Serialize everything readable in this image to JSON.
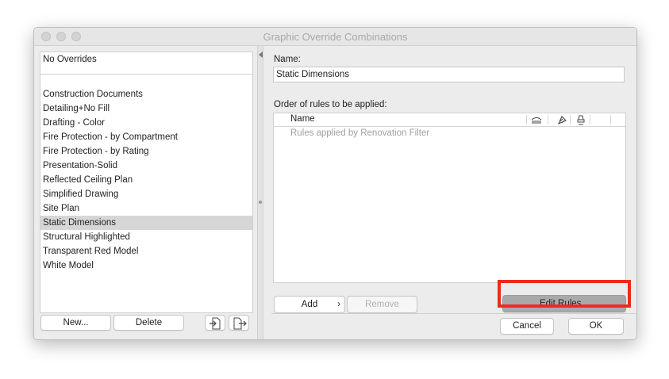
{
  "window": {
    "title": "Graphic Override Combinations"
  },
  "left": {
    "top_item": "No Overrides",
    "items": [
      {
        "label": "Construction Documents",
        "selected": false
      },
      {
        "label": "Detailing+No Fill",
        "selected": false
      },
      {
        "label": "Drafting - Color",
        "selected": false
      },
      {
        "label": "Fire Protection - by Compartment",
        "selected": false
      },
      {
        "label": "Fire Protection - by Rating",
        "selected": false
      },
      {
        "label": "Presentation-Solid",
        "selected": false
      },
      {
        "label": "Reflected Ceiling Plan",
        "selected": false
      },
      {
        "label": "Simplified Drawing",
        "selected": false
      },
      {
        "label": "Site Plan",
        "selected": false
      },
      {
        "label": "Static Dimensions",
        "selected": true
      },
      {
        "label": "Structural Highlighted",
        "selected": false
      },
      {
        "label": "Transparent Red Model",
        "selected": false
      },
      {
        "label": "White Model",
        "selected": false
      }
    ],
    "new_button": "New...",
    "delete_button": "Delete",
    "import_icon": "import-icon",
    "export_icon": "export-icon"
  },
  "right": {
    "name_label": "Name:",
    "name_value": "Static Dimensions",
    "order_label": "Order of rules to be applied:",
    "table": {
      "column_name": "Name",
      "column_icons": [
        "surface-override-icon",
        "fill-override-icon",
        "pen-override-icon"
      ],
      "rows": [
        "Rules applied by Renovation Filter"
      ]
    },
    "add_button": "Add",
    "add_chevron": "›",
    "remove_button": "Remove",
    "edit_rules_button": "Edit Rules...",
    "cancel_button": "Cancel",
    "ok_button": "OK"
  },
  "colors": {
    "highlight": "#ea2b1e",
    "selected_row": "#d6d6d6",
    "edit_rules_bg": "#a9a9a9"
  }
}
